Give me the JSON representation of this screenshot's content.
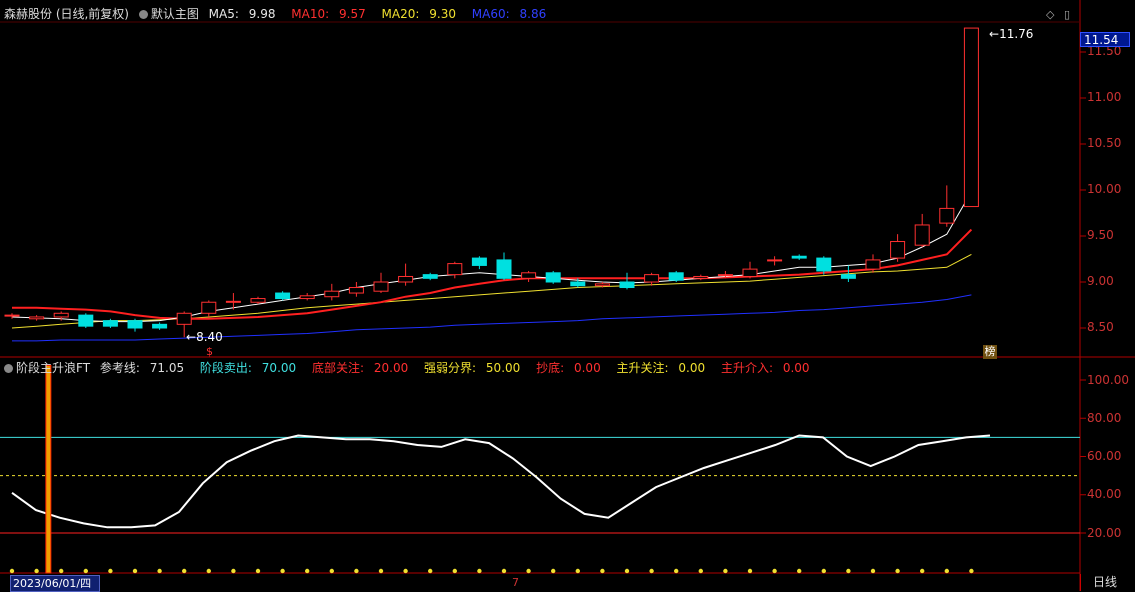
{
  "main_header": {
    "stock": "森赫股份 (日线,前复权)",
    "template": "默认主图",
    "ma5_label": "MA5:",
    "ma5_value": "9.98",
    "ma10_label": "MA10:",
    "ma10_value": "9.57",
    "ma20_label": "MA20:",
    "ma20_value": "9.30",
    "ma60_label": "MA60:",
    "ma60_value": "8.86"
  },
  "indicator_header": {
    "name": "阶段主升浪FT",
    "ref_label": "参考线:",
    "ref_value": "71.05",
    "sell_label": "阶段卖出:",
    "sell_value": "70.00",
    "bottom_label": "底部关注:",
    "bottom_value": "20.00",
    "strong_label": "强弱分界:",
    "strong_value": "50.00",
    "dip_label": "抄底:",
    "dip_value": "0.00",
    "rise_label": "主升关注:",
    "rise_value": "0.00",
    "enter_label": "主升介入:",
    "enter_value": "0.00"
  },
  "price_axis": [
    "11.50",
    "11.00",
    "10.50",
    "10.00",
    "9.50",
    "9.00",
    "8.50"
  ],
  "current_price": "11.54",
  "peak_label": "11.76",
  "low_label": "8.40",
  "indicator_axis": [
    "100.00",
    "80.00",
    "60.00",
    "40.00",
    "20.00"
  ],
  "markers": {
    "dollar": "$",
    "bang": "榜"
  },
  "date_label": "2023/06/01/四",
  "month_tick": "7",
  "period_button": "日线",
  "icons": {
    "diamond": "◇",
    "panel": "▯"
  },
  "colors": {
    "up": "#ff3030",
    "down": "#00e0e0",
    "ma5": "#ffffff",
    "ma10": "#ff2020",
    "ma20": "#f0e030",
    "ma60": "#2030ff"
  },
  "chart_data": [
    {
      "type": "candlestick",
      "title": "",
      "ylim": [
        8.3,
        11.9
      ],
      "candles": [
        [
          8.64,
          8.64,
          8.66,
          8.6
        ],
        [
          8.6,
          8.62,
          8.64,
          8.58
        ],
        [
          8.62,
          8.66,
          8.68,
          8.58
        ],
        [
          8.64,
          8.52,
          8.66,
          8.5
        ],
        [
          8.58,
          8.52,
          8.6,
          8.5
        ],
        [
          8.58,
          8.5,
          8.6,
          8.46
        ],
        [
          8.54,
          8.5,
          8.56,
          8.48
        ],
        [
          8.54,
          8.66,
          8.68,
          8.4
        ],
        [
          8.66,
          8.78,
          8.8,
          8.62
        ],
        [
          8.78,
          8.79,
          8.88,
          8.7
        ],
        [
          8.78,
          8.82,
          8.84,
          8.76
        ],
        [
          8.88,
          8.82,
          8.9,
          8.8
        ],
        [
          8.82,
          8.85,
          8.88,
          8.8
        ],
        [
          8.84,
          8.9,
          8.98,
          8.8
        ],
        [
          8.88,
          8.94,
          9.0,
          8.84
        ],
        [
          8.9,
          9.0,
          9.1,
          8.88
        ],
        [
          9.0,
          9.06,
          9.2,
          8.96
        ],
        [
          9.08,
          9.04,
          9.1,
          9.02
        ],
        [
          9.08,
          9.2,
          9.22,
          9.04
        ],
        [
          9.26,
          9.18,
          9.28,
          9.14
        ],
        [
          9.24,
          9.04,
          9.32,
          9.02
        ],
        [
          9.04,
          9.1,
          9.12,
          9.0
        ],
        [
          9.1,
          9.0,
          9.12,
          8.98
        ],
        [
          9.0,
          8.96,
          9.04,
          8.94
        ],
        [
          8.96,
          8.98,
          9.0,
          8.94
        ],
        [
          9.0,
          8.94,
          9.1,
          8.92
        ],
        [
          9.0,
          9.08,
          9.1,
          8.96
        ],
        [
          9.1,
          9.02,
          9.12,
          9.0
        ],
        [
          9.04,
          9.06,
          9.08,
          9.02
        ],
        [
          9.08,
          9.08,
          9.12,
          9.04
        ],
        [
          9.06,
          9.14,
          9.22,
          9.04
        ],
        [
          9.24,
          9.24,
          9.28,
          9.18
        ],
        [
          9.28,
          9.26,
          9.3,
          9.24
        ],
        [
          9.26,
          9.12,
          9.28,
          9.08
        ],
        [
          9.08,
          9.04,
          9.18,
          9.0
        ],
        [
          9.14,
          9.24,
          9.3,
          9.1
        ],
        [
          9.26,
          9.44,
          9.52,
          9.22
        ],
        [
          9.4,
          9.62,
          9.74,
          9.38
        ],
        [
          9.64,
          9.8,
          10.05,
          9.6
        ],
        [
          9.82,
          11.76,
          11.76,
          9.82
        ]
      ],
      "ma5": [
        8.62,
        8.61,
        8.6,
        8.58,
        8.57,
        8.57,
        8.58,
        8.62,
        8.68,
        8.72,
        8.76,
        8.8,
        8.84,
        8.88,
        8.94,
        8.98,
        9.02,
        9.06,
        9.08,
        9.1,
        9.08,
        9.06,
        9.04,
        9.02,
        9.0,
        8.99,
        9.0,
        9.02,
        9.04,
        9.06,
        9.08,
        9.12,
        9.16,
        9.16,
        9.18,
        9.2,
        9.26,
        9.38,
        9.52,
        9.98
      ],
      "ma10": [
        8.72,
        8.72,
        8.71,
        8.7,
        8.68,
        8.64,
        8.61,
        8.6,
        8.6,
        8.61,
        8.62,
        8.64,
        8.66,
        8.7,
        8.74,
        8.78,
        8.84,
        8.88,
        8.94,
        8.98,
        9.02,
        9.04,
        9.04,
        9.04,
        9.04,
        9.04,
        9.04,
        9.04,
        9.04,
        9.05,
        9.06,
        9.07,
        9.08,
        9.1,
        9.12,
        9.14,
        9.18,
        9.24,
        9.3,
        9.57
      ],
      "ma20": [
        8.5,
        8.52,
        8.54,
        8.56,
        8.58,
        8.58,
        8.59,
        8.6,
        8.62,
        8.64,
        8.66,
        8.69,
        8.72,
        8.74,
        8.76,
        8.78,
        8.8,
        8.82,
        8.84,
        8.86,
        8.88,
        8.9,
        8.92,
        8.94,
        8.95,
        8.96,
        8.97,
        8.98,
        8.99,
        9.0,
        9.01,
        9.03,
        9.05,
        9.07,
        9.09,
        9.11,
        9.12,
        9.14,
        9.16,
        9.3
      ],
      "ma60": [
        8.36,
        8.36,
        8.37,
        8.37,
        8.37,
        8.37,
        8.38,
        8.39,
        8.4,
        8.41,
        8.42,
        8.43,
        8.44,
        8.46,
        8.48,
        8.49,
        8.5,
        8.51,
        8.53,
        8.54,
        8.55,
        8.56,
        8.57,
        8.58,
        8.6,
        8.61,
        8.62,
        8.63,
        8.64,
        8.65,
        8.66,
        8.67,
        8.69,
        8.7,
        8.72,
        8.74,
        8.76,
        8.78,
        8.81,
        8.86
      ]
    },
    {
      "type": "line",
      "title": "",
      "ylim": [
        0,
        105
      ],
      "series": [
        {
          "name": "阶段主升浪FT",
          "values": [
            41,
            32,
            28,
            25,
            23,
            23,
            24,
            31,
            46,
            57,
            63,
            68,
            71,
            70,
            69,
            69,
            68,
            66,
            65,
            69,
            67,
            59,
            49,
            38,
            30,
            28,
            36,
            44,
            49,
            54,
            58,
            62,
            66,
            71,
            70,
            60,
            55,
            60,
            66,
            68,
            70,
            71
          ]
        }
      ],
      "reference_lines": [
        {
          "name": "阶段卖出",
          "value": 70
        },
        {
          "name": "强弱分界",
          "value": 50
        },
        {
          "name": "底部关注",
          "value": 20
        }
      ],
      "signal_bars": [
        {
          "index": 1,
          "value": 100
        }
      ]
    }
  ]
}
